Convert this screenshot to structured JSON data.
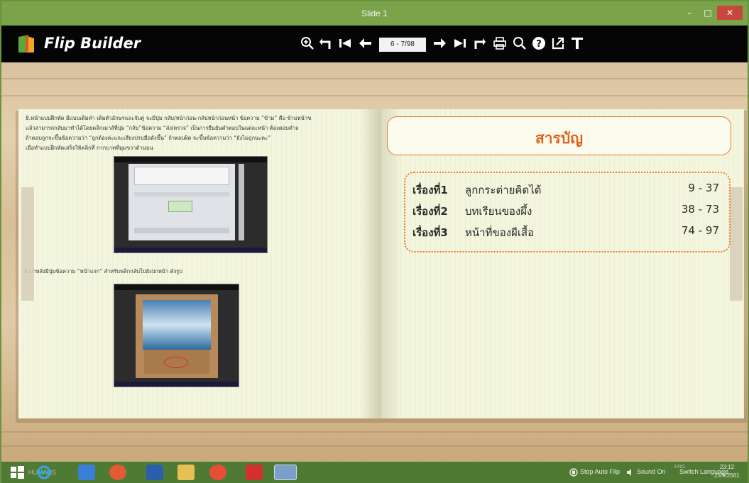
{
  "window": {
    "title": "Slide 1",
    "min": "–",
    "max": "□",
    "close": "✕"
  },
  "app": {
    "name": "Flip Builder"
  },
  "toolbar": {
    "page_indicator": "6 - 7/98",
    "icons": [
      "zoom-in-icon",
      "back-icon",
      "first-page-icon",
      "prev-page-icon",
      "next-page-icon",
      "last-page-icon",
      "forward-icon",
      "print-icon",
      "search-icon",
      "help-icon",
      "export-icon",
      "text-icon"
    ]
  },
  "left_page": {
    "step8_lines": [
      "8.หน้าแบบฝึกหัด มีแบบเติมคำ เติมตัวอักษรและจับคู่ จะมีปุ่ม กลับ/หน้าก่อน-กลับหน้าก่อนหน้า ข้อความ “ข้าม” คือ ข้ามหน้าข",
      "แล้วสามารถกลับมาทำได้โดยคลิกเมาส์ที่ปุ่ม “กลับ”ข้อความ “ส่ง/ตรวจ”   เป็นการยืนยันคำตอบในแต่ละหน้า ต้องตอบคำถ",
      "ถ้าตอบถูกจะขึ้นข้อความว่า “ถูกต้องค่ะและเสียงปรบมือดังขึ้น” ถ้าตอบผิด จะขึ้นข้อความว่า “ยังไม่ถูกนะคะ”",
      "เมื่อทำแบบฝึกหัดเสร็จให้คลิกที่ กากบาทที่มุมขวาด้านบน"
    ],
    "step9": "9.ปกหลังมีปุ่มข้อความ “หน้าแรก” สำหรับพลิกกลับไปยังปกหน้า ดังรูป"
  },
  "toc": {
    "title": "สารบัญ",
    "items": [
      {
        "num": "เรื่องที่1",
        "name": "ลูกกระต่ายคิดได้",
        "pages": "9 - 37"
      },
      {
        "num": "เรื่องที่2",
        "name": "บทเรียนของผึ้ง",
        "pages": "38 - 73"
      },
      {
        "num": "เรื่องที่3",
        "name": "หน้าที่ของผีเสื้อ",
        "pages": "74 - 97"
      }
    ]
  },
  "status": {
    "auto_flip": "Stop Auto Flip",
    "sound": "Sound On",
    "switch_language": "Switch Language",
    "lang_code": "ENG",
    "time": "23:12",
    "date": "25/9/2561"
  },
  "taskbar": {
    "search_text": "HUMANS"
  },
  "colors": {
    "accent": "#e0601d",
    "toolbar": "#050505",
    "window": "#7aa34a"
  }
}
